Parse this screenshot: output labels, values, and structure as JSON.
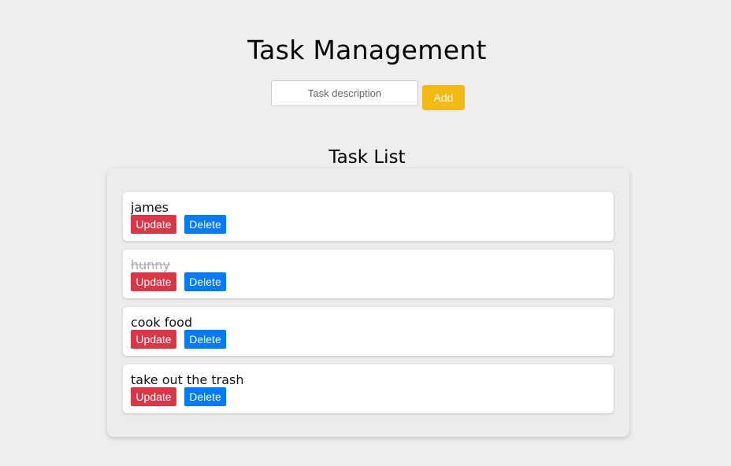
{
  "header": {
    "title": "Task Management"
  },
  "form": {
    "input_placeholder": "Task description",
    "input_value": "",
    "add_label": "Add"
  },
  "list": {
    "heading": "Task List",
    "update_label": "Update",
    "delete_label": "Delete",
    "tasks": [
      {
        "text": "james",
        "completed": false
      },
      {
        "text": "hunny",
        "completed": true
      },
      {
        "text": "cook food",
        "completed": false
      },
      {
        "text": "take out the trash",
        "completed": false
      }
    ]
  },
  "colors": {
    "background": "#eeeeee",
    "add_button": "#f5b914",
    "update_button": "#dc3545",
    "delete_button": "#007bff",
    "completed_text": "#aaaaaa"
  }
}
